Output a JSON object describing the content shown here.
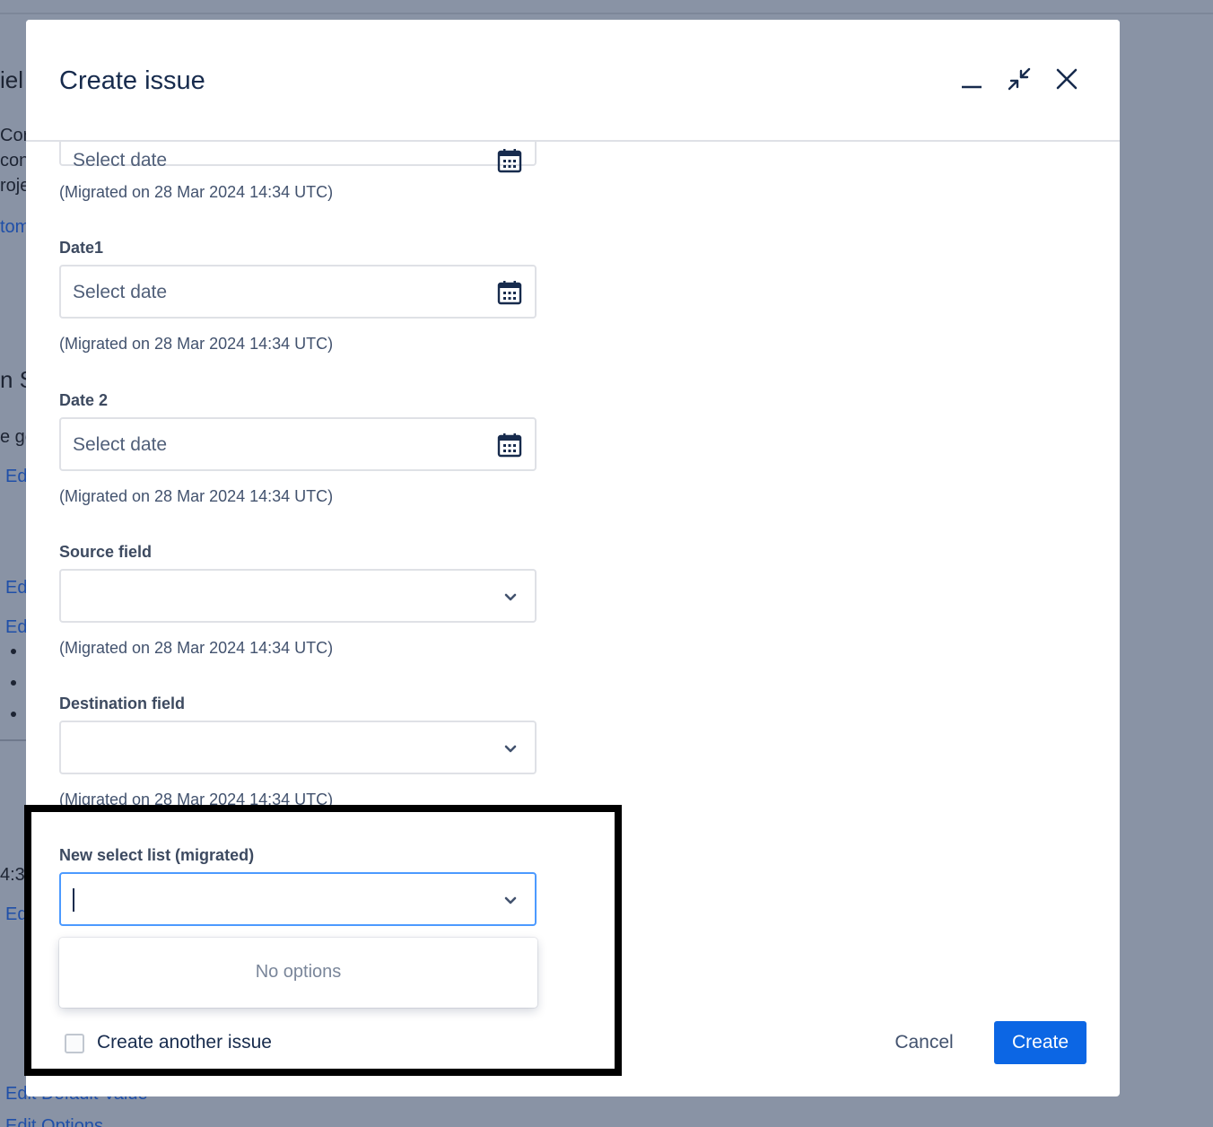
{
  "background": {
    "fragments": [
      "iel",
      "Cor",
      "con",
      "roje",
      "tom",
      "n S",
      "e ge",
      "Ed",
      "Ed",
      "Ed",
      "4:3",
      "Ed",
      "Edit Default Value",
      "Edit Options"
    ]
  },
  "modal": {
    "title": "Create issue",
    "buttons": {
      "minimize": "minimize-icon",
      "collapse": "collapse-icon",
      "close": "close-icon"
    }
  },
  "fields": {
    "top_date": {
      "placeholder": "Select date",
      "help": "(Migrated on 28 Mar 2024 14:34 UTC)"
    },
    "date1": {
      "label": "Date1",
      "placeholder": "Select date",
      "help": "(Migrated on 28 Mar 2024 14:34 UTC)"
    },
    "date2": {
      "label": "Date 2",
      "placeholder": "Select date",
      "help": "(Migrated on 28 Mar 2024 14:34 UTC)"
    },
    "source": {
      "label": "Source field",
      "value": "",
      "help": "(Migrated on 28 Mar 2024 14:34 UTC)"
    },
    "destination": {
      "label": "Destination field",
      "value": "",
      "help": "(Migrated on 28 Mar 2024 14:34 UTC)"
    },
    "new_select": {
      "label": "New select list (migrated)",
      "value": "",
      "dropdown_message": "No options"
    }
  },
  "footer": {
    "create_another_label": "Create another issue",
    "create_another_checked": false,
    "cancel_label": "Cancel",
    "create_label": "Create"
  },
  "colors": {
    "primary": "#0c66e4",
    "focus": "#4c9aff",
    "overlay": "#8993a5"
  }
}
